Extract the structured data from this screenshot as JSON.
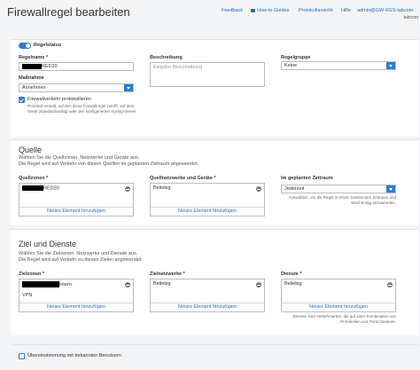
{
  "page": {
    "title": "Firewallregel bearbeiten"
  },
  "nav": {
    "feedback": "Feedback",
    "how_to": "How-to Guides",
    "protokoll": "Protokollansicht",
    "hilfe": "Hilfe",
    "user": "admin@GW-XGS-tabcom",
    "tenant": "tabcom"
  },
  "regel": {
    "status_label": "Regelstatus",
    "name_label": "Regelname *",
    "name_value_suffix": "RED20",
    "beschreibung_label": "Beschreibung",
    "beschreibung_placeholder": "Eingabe Beschreibung",
    "gruppe_label": "Regelgruppe",
    "gruppe_value": "Keine",
    "massnahme_label": "Maßnahme",
    "massnahme_value": "Annehmen",
    "log_label": "Firewallverkehr protokollieren",
    "log_help": "Protokoll verteilt, auf den diese Firewallregel zutrifft, auf dem Gerät (standardmäßig) oder den konfigurierten Syslog-Server."
  },
  "quelle": {
    "title": "Quelle",
    "sub1": "Wählen Sie die Quellzonen, Netzwerke und Geräte aus.",
    "sub2": "Die Regel wird auf Verkehr von diesen Quellen im geplanten Zeitraum angewendet.",
    "zonen_label": "Quellzonen *",
    "zonen_item_suffix": "RED20",
    "netz_label": "Quellnetzwerke und Geräte *",
    "netz_item": "Beliebig",
    "zeit_label": "Im geplanten Zeitraum",
    "zeit_value": "Jederzeit",
    "zeit_help": "Auswahlen, um die Regel in einem bestimmten Zeitraum und Wochentag anzuwenden.",
    "add_label": "Neues Element hinzufügen"
  },
  "ziel": {
    "title": "Ziel und Dienste",
    "sub1": "Wählen Sie die Zielzonen, Netzwerke und Dienste aus.",
    "sub2": "Die Regel wird auf Verkehr zu diesen Zielen angewendet.",
    "zonen_label": "Zielzonen *",
    "zonen_item1_suffix": "intern",
    "zonen_item2": "VPN",
    "netz_label": "Zielnetzwerke *",
    "netz_item": "Beliebig",
    "dienste_label": "Dienste *",
    "dienste_item": "Beliebig",
    "dienste_help": "Dienste sind Verkehrsarten, die auf einer Kombination von Protokollen und Ports basieren.",
    "add_label": "Neues Element hinzufügen"
  },
  "footer": {
    "users_label": "Übereinstimmung mit bekannten Benutzern"
  }
}
